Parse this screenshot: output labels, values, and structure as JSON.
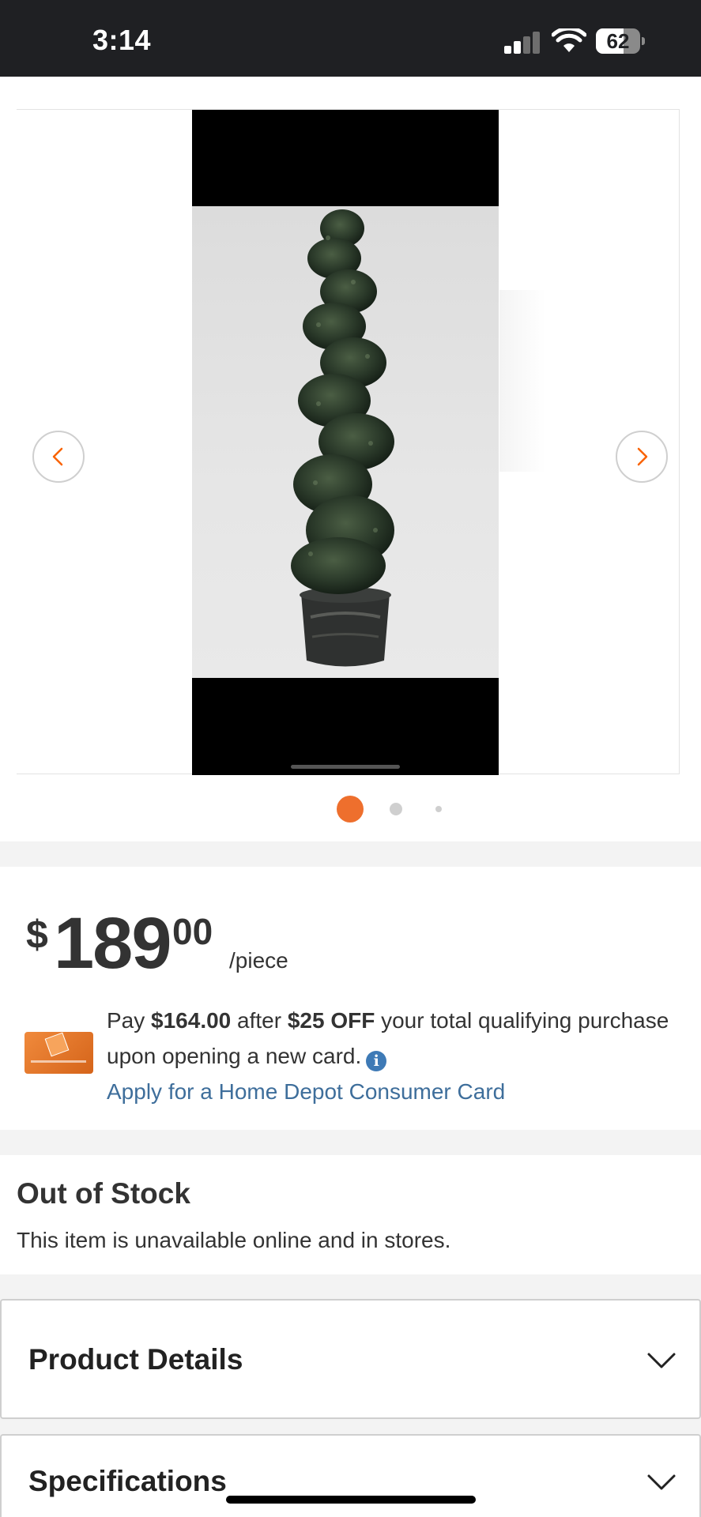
{
  "status_bar": {
    "time": "3:14",
    "battery_level": "62",
    "battery_fraction": 0.62
  },
  "gallery": {
    "image_alt": "Spiral topiary tree in pot",
    "prev_icon": "chevron-left-icon",
    "next_icon": "chevron-right-icon",
    "dot_count": 3,
    "active_dot": 0,
    "accent_color": "#f96302"
  },
  "price": {
    "currency": "$",
    "dollars": "189",
    "cents": "00",
    "unit": "/piece"
  },
  "promo": {
    "text_pay": "Pay ",
    "amount": "$164.00",
    "text_after": " after ",
    "discount": "$25 OFF",
    "text_rest": " your total qualifying purchase upon opening a new card.",
    "info_icon": "i",
    "apply_link": "Apply for a Home Depot Consumer Card",
    "link_color": "#3e6e9b"
  },
  "stock": {
    "title": "Out of Stock",
    "description": "This item is unavailable online and in stores."
  },
  "sections": {
    "product_details": "Product Details",
    "specifications": "Specifications"
  }
}
